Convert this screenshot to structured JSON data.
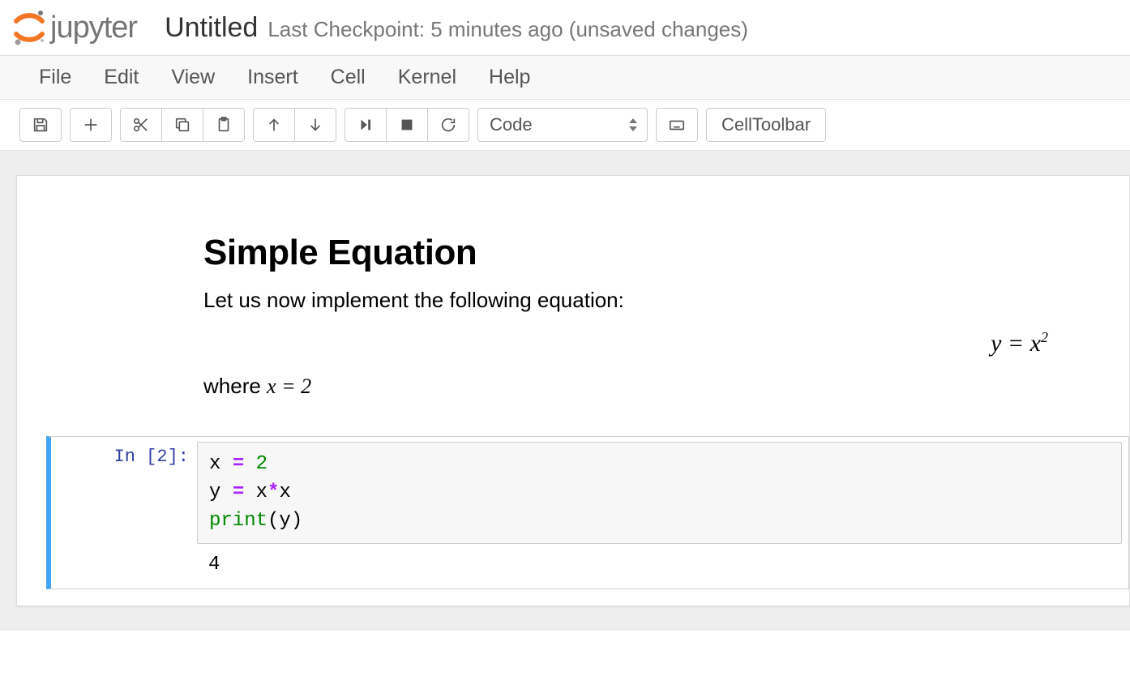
{
  "header": {
    "logo_text": "jupyter",
    "title": "Untitled",
    "checkpoint": "Last Checkpoint: 5 minutes ago (unsaved changes)"
  },
  "menubar": [
    "File",
    "Edit",
    "View",
    "Insert",
    "Cell",
    "Kernel",
    "Help"
  ],
  "toolbar": {
    "celltype_selected": "Code",
    "celltoolbar_label": "CellToolbar"
  },
  "markdown": {
    "heading": "Simple Equation",
    "intro": "Let us now implement the following equation:",
    "equation_html": "<span>y</span> = <span>x</span><sup>2</sup>",
    "where_prefix": "where ",
    "where_math": "x = 2"
  },
  "codecell": {
    "prompt": "In [2]:",
    "lines": [
      {
        "raw": "x = 2",
        "tokens": [
          [
            "name",
            "x"
          ],
          [
            "plain",
            " "
          ],
          [
            "op",
            "="
          ],
          [
            "plain",
            " "
          ],
          [
            "num",
            "2"
          ]
        ]
      },
      {
        "raw": "y = x*x",
        "tokens": [
          [
            "name",
            "y"
          ],
          [
            "plain",
            " "
          ],
          [
            "op",
            "="
          ],
          [
            "plain",
            " "
          ],
          [
            "name",
            "x"
          ],
          [
            "op",
            "*"
          ],
          [
            "name",
            "x"
          ]
        ]
      },
      {
        "raw": "print(y)",
        "tokens": [
          [
            "builtin",
            "print"
          ],
          [
            "paren",
            "("
          ],
          [
            "name",
            "y"
          ],
          [
            "paren",
            ")"
          ]
        ]
      }
    ],
    "output": "4"
  }
}
